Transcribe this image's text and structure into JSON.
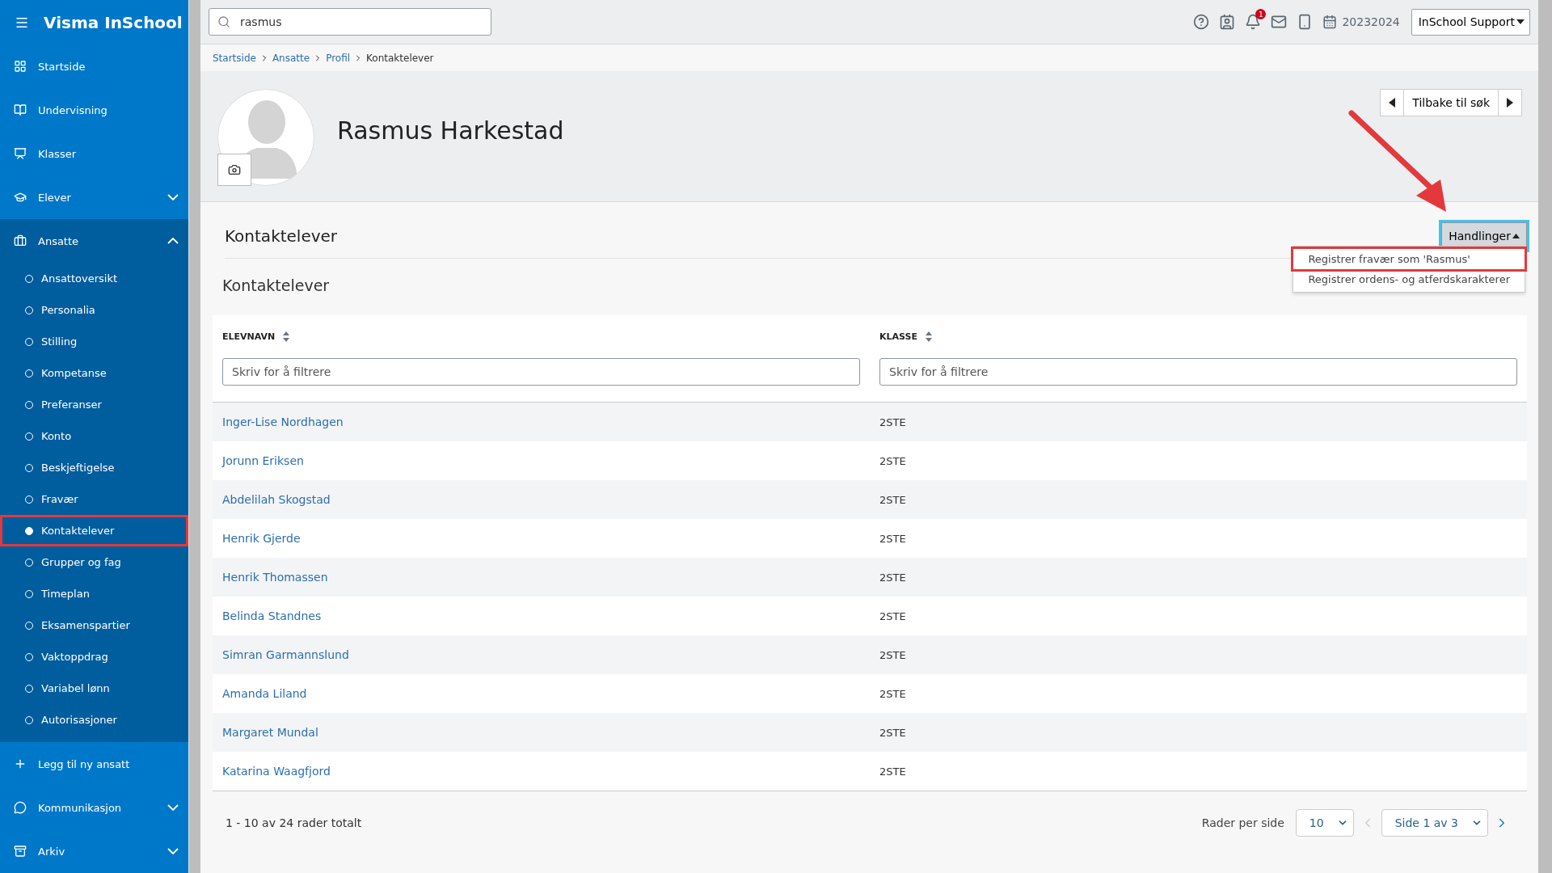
{
  "app": {
    "title": "Visma InSchool"
  },
  "sidebar": {
    "items": [
      {
        "kind": "link",
        "label": "Startside"
      },
      {
        "kind": "link",
        "label": "Undervisning"
      },
      {
        "kind": "link",
        "label": "Klasser"
      },
      {
        "kind": "group",
        "label": "Elever",
        "expanded": false
      },
      {
        "kind": "group",
        "label": "Ansatte",
        "expanded": true,
        "children": [
          {
            "label": "Ansattoversikt",
            "selected": false,
            "highlighted": false
          },
          {
            "label": "Personalia",
            "selected": false,
            "highlighted": false
          },
          {
            "label": "Stilling",
            "selected": false,
            "highlighted": false
          },
          {
            "label": "Kompetanse",
            "selected": false,
            "highlighted": false
          },
          {
            "label": "Preferanser",
            "selected": false,
            "highlighted": false
          },
          {
            "label": "Konto",
            "selected": false,
            "highlighted": false
          },
          {
            "label": "Beskjeftigelse",
            "selected": false,
            "highlighted": false
          },
          {
            "label": "Fravær",
            "selected": false,
            "highlighted": false
          },
          {
            "label": "Kontaktelever",
            "selected": true,
            "highlighted": true
          },
          {
            "label": "Grupper og fag",
            "selected": false,
            "highlighted": false
          },
          {
            "label": "Timeplan",
            "selected": false,
            "highlighted": false
          },
          {
            "label": "Eksamenspartier",
            "selected": false,
            "highlighted": false
          },
          {
            "label": "Vaktoppdrag",
            "selected": false,
            "highlighted": false
          },
          {
            "label": "Variabel lønn",
            "selected": false,
            "highlighted": false
          },
          {
            "label": "Autorisasjoner",
            "selected": false,
            "highlighted": false
          }
        ]
      },
      {
        "kind": "action",
        "label": "Legg til ny ansatt"
      },
      {
        "kind": "group",
        "label": "Kommunikasjon",
        "expanded": false
      },
      {
        "kind": "group",
        "label": "Arkiv",
        "expanded": false
      }
    ]
  },
  "topbar": {
    "search": {
      "value": "rasmus"
    },
    "notification_count": "1",
    "school_year": "20232024",
    "user_menu": "InSchool Support"
  },
  "breadcrumb": [
    {
      "label": "Startside",
      "link": true
    },
    {
      "label": "Ansatte",
      "link": true
    },
    {
      "label": "Profil",
      "link": true
    },
    {
      "label": "Kontaktelever",
      "link": false
    }
  ],
  "profile": {
    "name": "Rasmus Harkestad",
    "back_button": "Tilbake til søk"
  },
  "section": {
    "title": "Kontaktelever",
    "actions_button": "Handlinger",
    "actions_open": true,
    "actions_menu": [
      {
        "label": "Registrer fravær som 'Rasmus'",
        "highlighted": true
      },
      {
        "label": "Registrer ordens- og atferdskarakterer",
        "highlighted": false
      }
    ]
  },
  "table": {
    "title": "Kontaktelever",
    "columns": [
      {
        "label": "ELEVNAVN",
        "filter_placeholder": "Skriv for å filtrere"
      },
      {
        "label": "KLASSE",
        "filter_placeholder": "Skriv for å filtrere"
      }
    ],
    "rows": [
      {
        "name": "Inger-Lise Nordhagen",
        "class": "2STE"
      },
      {
        "name": "Jorunn Eriksen",
        "class": "2STE"
      },
      {
        "name": "Abdelilah Skogstad",
        "class": "2STE"
      },
      {
        "name": "Henrik Gjerde",
        "class": "2STE"
      },
      {
        "name": "Henrik Thomassen",
        "class": "2STE"
      },
      {
        "name": "Belinda Standnes",
        "class": "2STE"
      },
      {
        "name": "Simran Garmannslund",
        "class": "2STE"
      },
      {
        "name": "Amanda Liland",
        "class": "2STE"
      },
      {
        "name": "Margaret Mundal",
        "class": "2STE"
      },
      {
        "name": "Katarina Waagfjord",
        "class": "2STE"
      }
    ]
  },
  "pagination": {
    "summary": "1 - 10 av 24 rader totalt",
    "rows_per_page_label": "Rader per side",
    "rows_per_page": "10",
    "page": "Side 1 av 3"
  }
}
